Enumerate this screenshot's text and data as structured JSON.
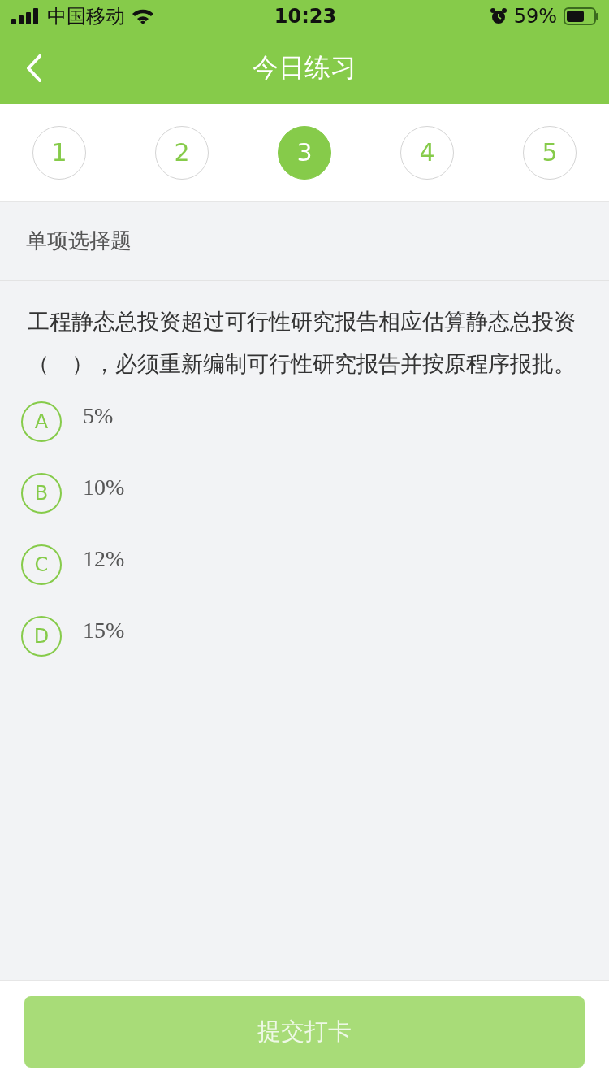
{
  "status_bar": {
    "carrier": "中国移动",
    "time": "10:23",
    "battery": "59%"
  },
  "nav": {
    "title": "今日练习"
  },
  "question_numbers": [
    {
      "label": "1",
      "selected": false
    },
    {
      "label": "2",
      "selected": false
    },
    {
      "label": "3",
      "selected": true
    },
    {
      "label": "4",
      "selected": false
    },
    {
      "label": "5",
      "selected": false
    }
  ],
  "section_title": "单项选择题",
  "question": "工程静态总投资超过可行性研究报告相应估算静态总投资（　），必须重新编制可行性研究报告并按原程序报批。",
  "options": [
    {
      "letter": "A",
      "text": "5%",
      "selected": false
    },
    {
      "letter": "B",
      "text": "10%",
      "selected": false
    },
    {
      "letter": "C",
      "text": "12%",
      "selected": false
    },
    {
      "letter": "D",
      "text": "15%",
      "selected": false
    }
  ],
  "submit": {
    "label": "提交打卡",
    "disabled": true
  }
}
